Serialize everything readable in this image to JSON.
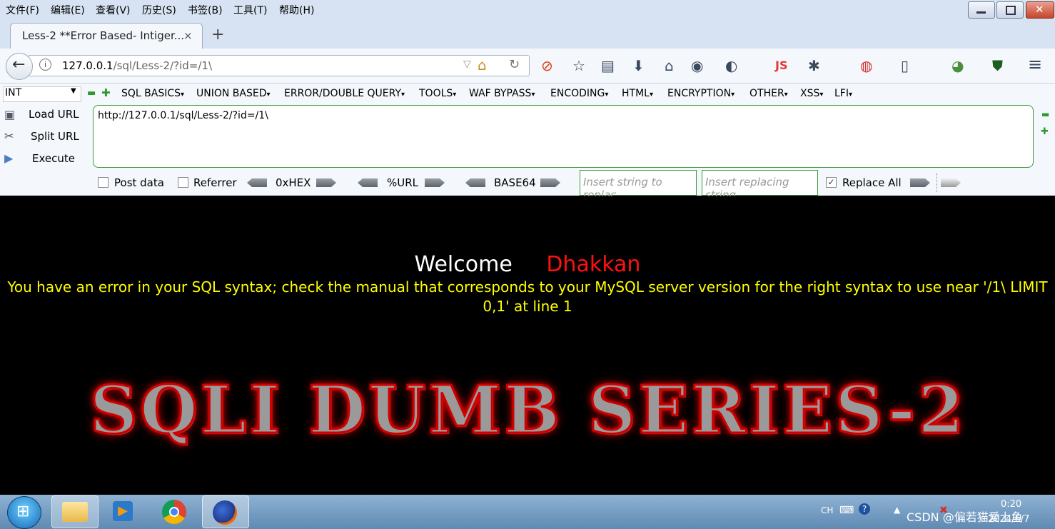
{
  "menubar": {
    "items": [
      "文件(F)",
      "编辑(E)",
      "查看(V)",
      "历史(S)",
      "书签(B)",
      "工具(T)",
      "帮助(H)"
    ]
  },
  "tab": {
    "title": "Less-2 **Error Based- Intiger...",
    "close": "×",
    "new_tab": "+"
  },
  "navbar": {
    "url_host": "127.0.0.1",
    "url_path": "/sql/Less-2/?id=/1\\",
    "js_label": "JS"
  },
  "hackbar": {
    "type_select": "INT",
    "menus": [
      "SQL BASICS",
      "UNION BASED",
      "ERROR/DOUBLE QUERY",
      "TOOLS",
      "WAF BYPASS",
      "ENCODING",
      "HTML",
      "ENCRYPTION",
      "OTHER",
      "XSS",
      "LFI"
    ],
    "load_url": "Load URL",
    "split_url": "Split URL",
    "execute": "Execute",
    "url_value": "http://127.0.0.1/sql/Less-2/?id=/1\\",
    "post_data": "Post data",
    "referrer": "Referrer",
    "hex": "0xHEX",
    "url_enc": "%URL",
    "base64": "BASE64",
    "replace_from_placeholder": "Insert string to replac",
    "replace_to_placeholder": "Insert replacing string",
    "replace_all": "Replace All",
    "replace_all_checked": true
  },
  "page": {
    "welcome": "Welcome",
    "name": "Dhakkan",
    "error": "You have an error in your SQL syntax; check the manual that corresponds to your MySQL server version for the right syntax to use near '/1\\ LIMIT 0,1' at line 1",
    "banner": "SQLI DUMB SERIES-2"
  },
  "taskbar": {
    "lang": "CH",
    "time": "0:20",
    "date": "2024/6/7",
    "watermark": "CSDN @偏若猫爱上鱼"
  }
}
